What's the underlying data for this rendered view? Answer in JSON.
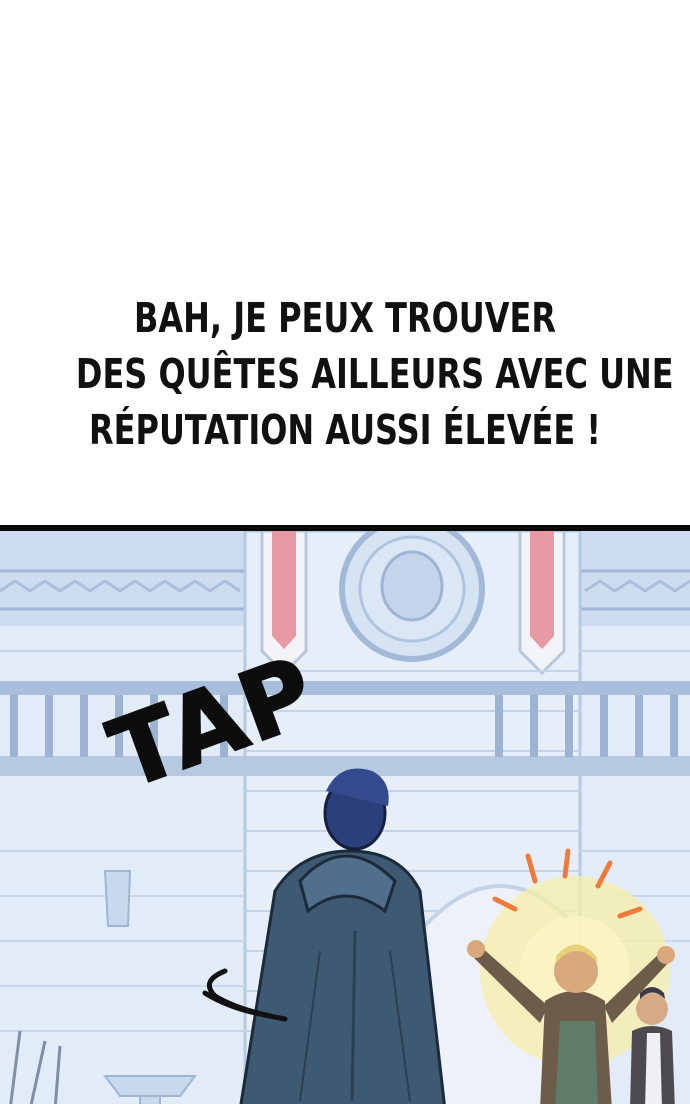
{
  "caption": {
    "lines": [
      "BAH, JE PEUX TROUVER",
      "DES QUÊTES AILLEURS AVEC UNE",
      "RÉPUTATION AUSSI ÉLEVÉE !"
    ]
  },
  "panel": {
    "sound_effect": "TAP"
  },
  "colors": {
    "background": "#ffffff",
    "text": "#111111",
    "panel_border": "#0a0a0a",
    "wall": "#dfe9f7",
    "banner": "#e9a0a8",
    "cloak": "#3f5a73",
    "glow": "#f5e28a",
    "burst": "#f07a3c"
  }
}
